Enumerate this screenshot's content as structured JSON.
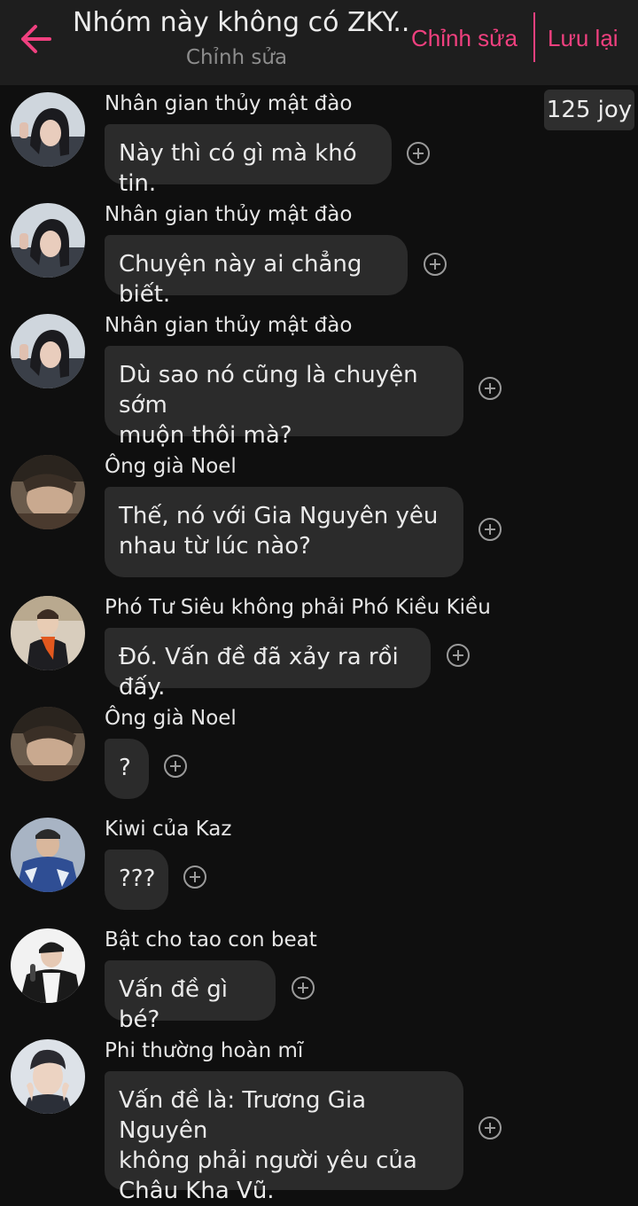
{
  "header": {
    "title": "Nhóm này không có ZKY...",
    "subtitle": "Chỉnh sửa",
    "edit_label": "Chỉnh sửa",
    "save_label": "Lưu lại",
    "accent_color": "#f0407f"
  },
  "joy_badge": "125 joy",
  "messages": [
    {
      "sender": "Nhân gian thủy mật đào",
      "text": "Này thì có gì mà khó tin.",
      "avatar": "avatar-girl"
    },
    {
      "sender": "Nhân gian thủy mật đào",
      "text": "Chuyện này ai chẳng biết.",
      "avatar": "avatar-girl"
    },
    {
      "sender": "Nhân gian thủy mật đào",
      "text": "Dù sao nó cũng là chuyện sớm\nmuộn thôi mà?",
      "avatar": "avatar-girl"
    },
    {
      "sender": "Ông già Noel",
      "text": "Thế, nó với Gia Nguyên yêu\nnhau từ lúc nào?",
      "avatar": "avatar-noel"
    },
    {
      "sender": "Phó Tư Siêu không phải Phó Kiều Kiều",
      "text": "Đó. Vấn đề đã xảy ra rồi đấy.",
      "avatar": "avatar-scarf"
    },
    {
      "sender": "Ông già Noel",
      "text": "?",
      "avatar": "avatar-noel"
    },
    {
      "sender": "Kiwi của Kaz",
      "text": "???",
      "avatar": "avatar-kiwi"
    },
    {
      "sender": "Bật cho tao con beat",
      "text": "Vấn đề gì bé?",
      "avatar": "avatar-singer"
    },
    {
      "sender": "Phi thường hoàn mĩ",
      "text": "Vấn đề là: Trương Gia Nguyên\nkhông phải người yêu của\nChâu Kha Vũ.",
      "avatar": "avatar-boy"
    }
  ]
}
